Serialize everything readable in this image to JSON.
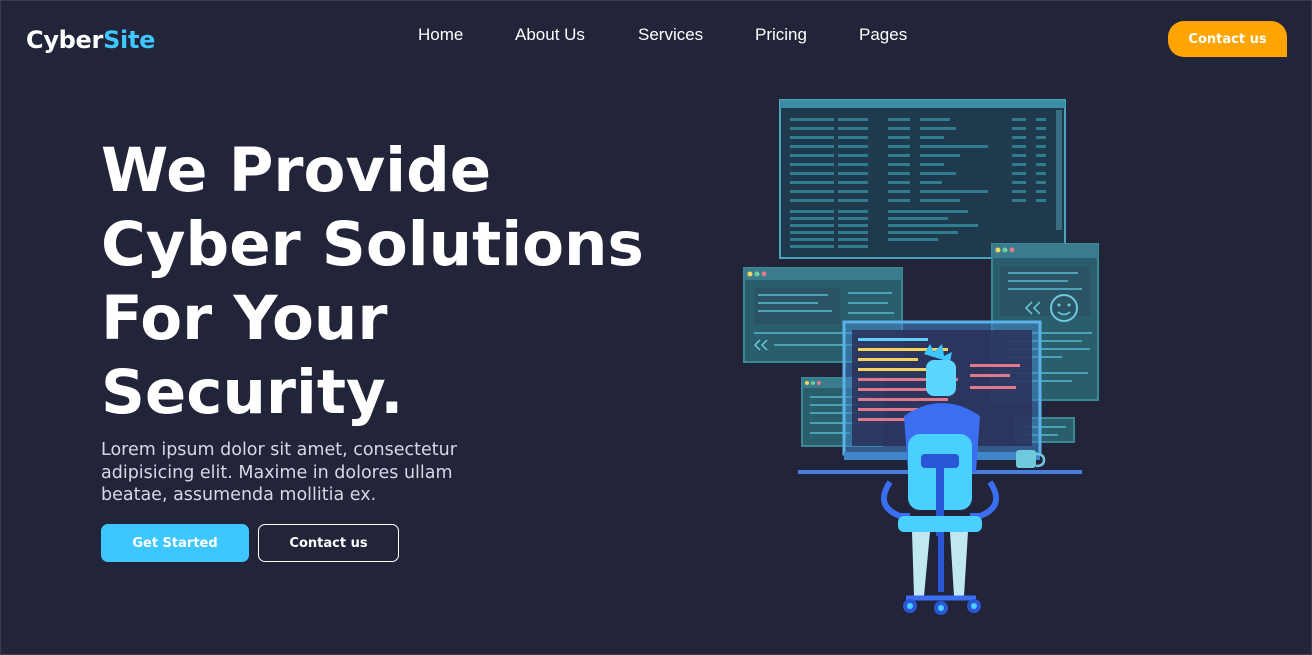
{
  "header": {
    "logo_part1": "Cyber",
    "logo_part2": "Site",
    "nav": [
      {
        "label": "Home"
      },
      {
        "label": "About Us"
      },
      {
        "label": "Services"
      },
      {
        "label": "Pricing"
      },
      {
        "label": "Pages"
      }
    ],
    "cta_label": "Contact us"
  },
  "hero": {
    "title": "We Provide Cyber Solutions For Your Security.",
    "description": "Lorem ipsum dolor sit amet, consectetur adipisicing elit. Maxime in dolores ullam beatae, assumenda mollitia ex.",
    "primary_button": "Get Started",
    "secondary_button": "Contact us"
  },
  "colors": {
    "background": "#22243a",
    "accent": "#3ec6ff",
    "cta": "#ffa400"
  }
}
